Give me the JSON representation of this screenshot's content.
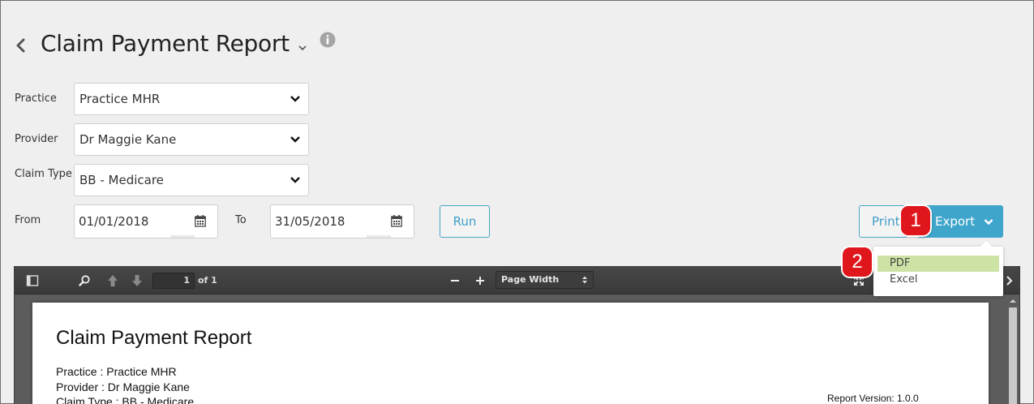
{
  "header": {
    "title": "Claim Payment Report"
  },
  "form": {
    "practice_label": "Practice",
    "practice_value": "Practice MHR",
    "provider_label": "Provider",
    "provider_value": "Dr Maggie Kane",
    "claim_type_label": "Claim Type",
    "claim_type_value": "BB - Medicare",
    "from_label": "From",
    "from_value": "01/01/2018",
    "to_label": "To",
    "to_value": "31/05/2018",
    "run_label": "Run"
  },
  "actions": {
    "print_label": "Print",
    "export_label": "Export",
    "export_options": [
      "PDF",
      "Excel"
    ]
  },
  "badges": {
    "one": "1",
    "two": "2"
  },
  "viewer": {
    "page_number": "1",
    "page_of": "of 1",
    "zoom": "Page Width",
    "document": {
      "title": "Claim Payment Report",
      "practice_line": "Practice : Practice MHR",
      "provider_line": "Provider : Dr Maggie Kane",
      "claim_type_line": "Claim Type : BB -  Medicare",
      "version_line": "Report Version: 1.0.0"
    }
  },
  "colors": {
    "accent": "#3fa5cb",
    "badge": "#e0161d",
    "menu_highlight": "#cde3a5",
    "background": "#efefef"
  }
}
